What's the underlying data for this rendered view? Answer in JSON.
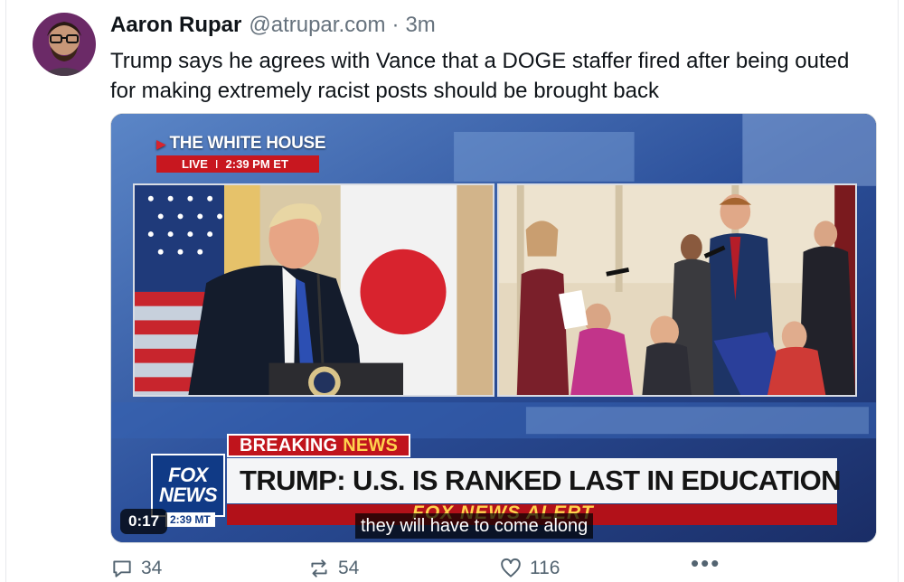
{
  "post": {
    "author_name": "Aaron Rupar",
    "author_handle": "@atrupar.com",
    "separator": "·",
    "timestamp": "3m",
    "text": "Trump says he agrees with Vance that a DOGE staffer fired after being outed for making extremely racist posts should be brought back"
  },
  "video": {
    "location_label": "THE WHITE HOUSE",
    "live_label": "LIVE",
    "live_separator": "I",
    "live_time": "2:39 PM ET",
    "breaking_label": "BREAKING",
    "breaking_label_gold": "NEWS",
    "headline": "TRUMP: U.S. IS RANKED LAST IN EDUCATION",
    "alert_text": "FOX NEWS ALERT",
    "network_logo_line1": "FOX",
    "network_logo_line2": "NEWS",
    "network_time": "2:39 MT",
    "duration": "0:17",
    "caption": "they will have to come along"
  },
  "actions": {
    "reply_count": "34",
    "repost_count": "54",
    "like_count": "116",
    "more_label": "•••"
  },
  "colors": {
    "text_primary": "#0f1419",
    "text_secondary": "#66727d",
    "fox_red": "#c0141c",
    "fox_blue": "#103a86",
    "fox_gold": "#ffd34d"
  },
  "icons": [
    "reply-icon",
    "repost-icon",
    "like-icon",
    "more-icon",
    "play-arrow-icon"
  ]
}
